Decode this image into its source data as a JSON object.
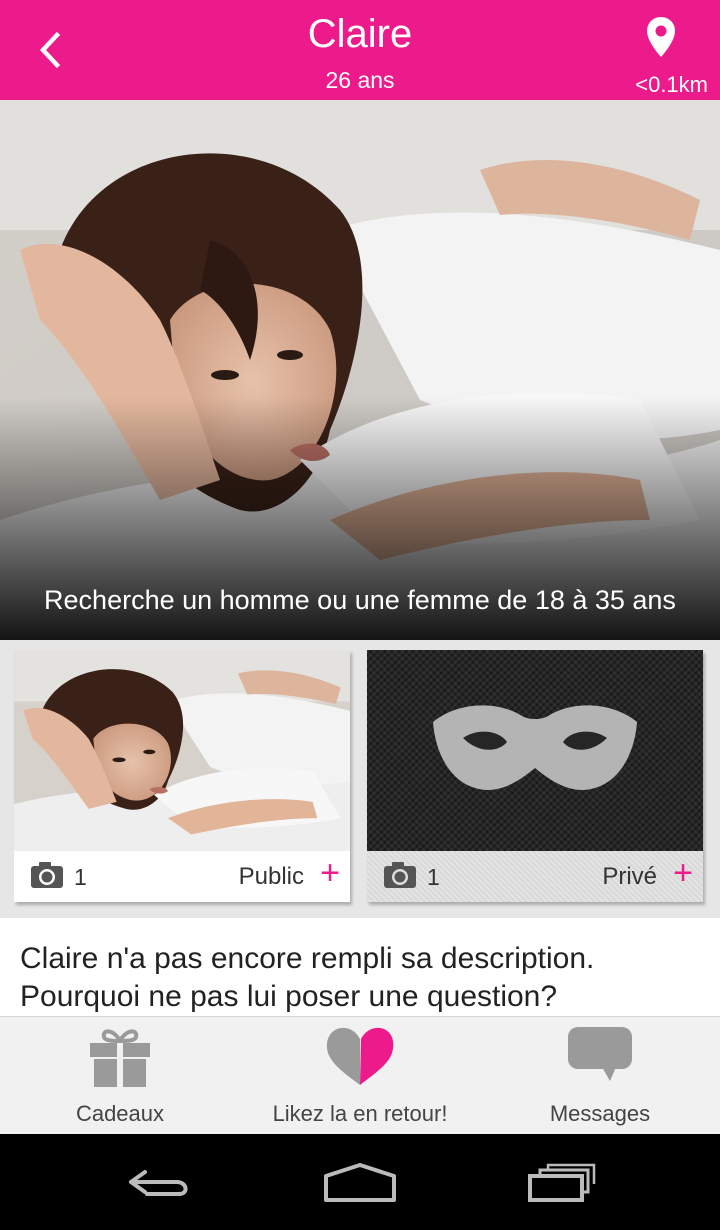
{
  "header": {
    "name": "Claire",
    "age": "26 ans",
    "distance": "<0.1km",
    "color": "#ec1a8a"
  },
  "hero": {
    "caption": "Recherche un homme ou une femme de 18 à 35 ans"
  },
  "albums": [
    {
      "type": "public",
      "count": "1",
      "label": "Public",
      "plus": "+"
    },
    {
      "type": "private",
      "count": "1",
      "label": "Privé",
      "plus": "+"
    }
  ],
  "description": {
    "text": "Claire n'a pas encore rempli sa description. Pourquoi ne pas lui poser une question?"
  },
  "tabs": [
    {
      "label": "Cadeaux",
      "icon": "gift-icon"
    },
    {
      "label": "Likez la en retour!",
      "icon": "heart-icon"
    },
    {
      "label": "Messages",
      "icon": "chat-bubble-icon"
    }
  ],
  "system_nav": [
    "back-icon",
    "home-icon",
    "recents-icon"
  ]
}
